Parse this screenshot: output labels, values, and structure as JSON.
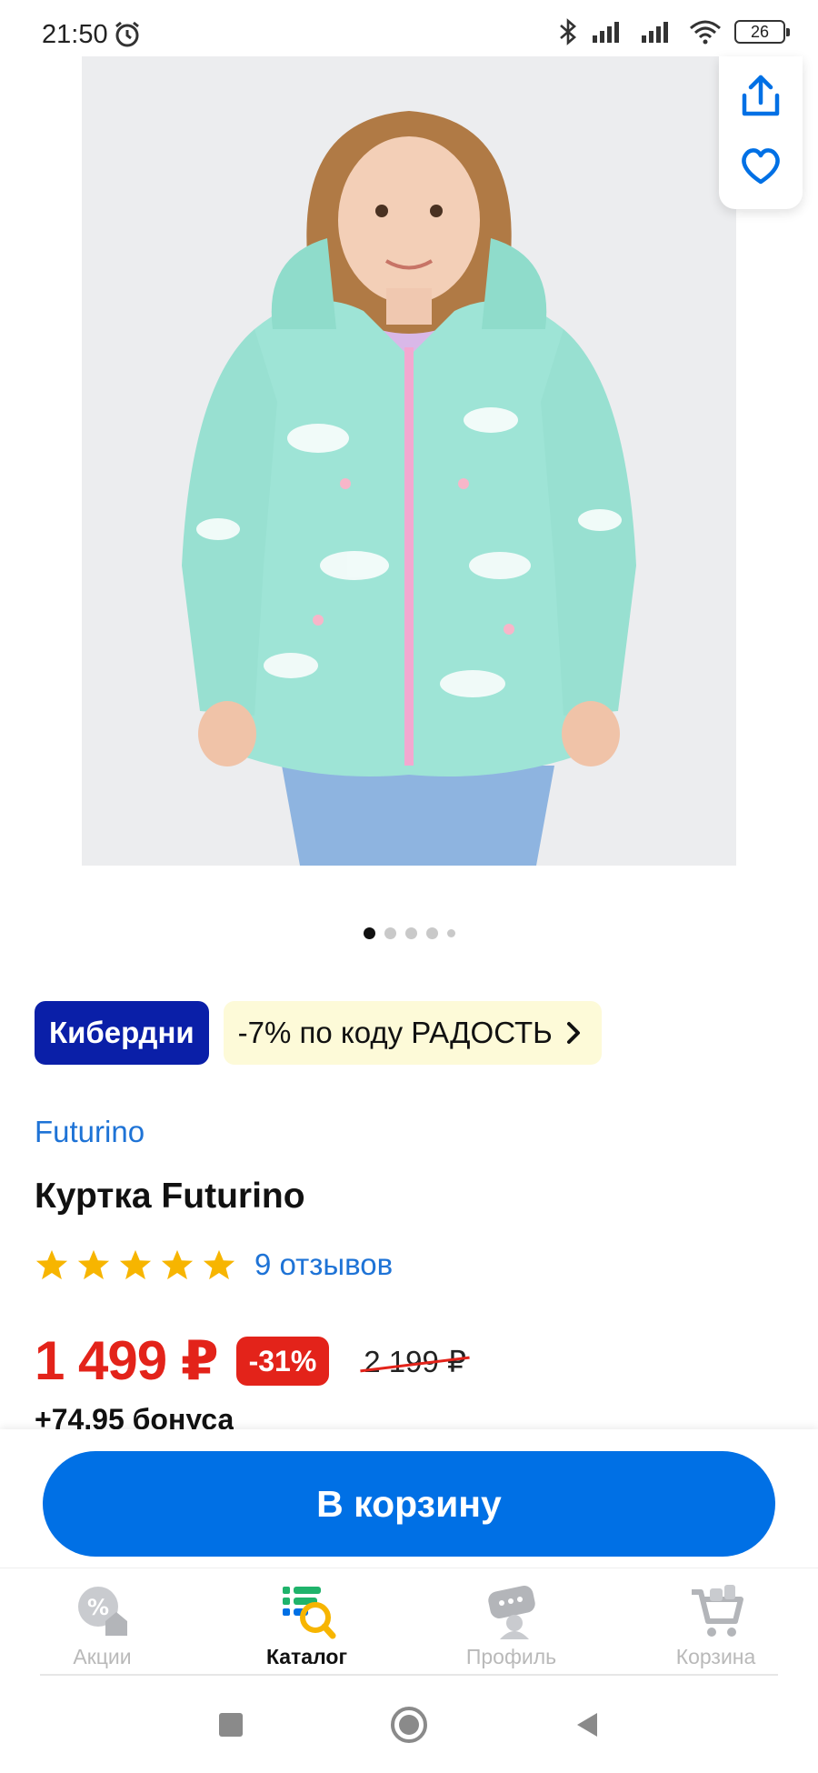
{
  "status_bar": {
    "time": "21:50",
    "battery": "26"
  },
  "floating_actions": {
    "share_icon": "share-icon",
    "favorite_icon": "heart-icon"
  },
  "gallery": {
    "dots": 5,
    "active_index": 0
  },
  "promo": {
    "badge_label": "Кибердни",
    "code_label": "-7% по коду РАДОСТЬ"
  },
  "product": {
    "brand": "Futurino",
    "title": "Куртка Futurino",
    "rating": 5,
    "reviews_label": "9 отзывов",
    "price": "1 499 ₽",
    "discount": "-31%",
    "old_price": "2 199 ₽",
    "bonus": "+74,95 бонуса"
  },
  "cart_button_label": "В корзину",
  "tabs": [
    {
      "label": "Акции",
      "icon": "percent-house-icon",
      "active": false
    },
    {
      "label": "Каталог",
      "icon": "catalog-search-icon",
      "active": true
    },
    {
      "label": "Профиль",
      "icon": "profile-icon",
      "active": false
    },
    {
      "label": "Корзина",
      "icon": "cart-icon",
      "active": false
    }
  ],
  "colors": {
    "accent_blue": "#0070e5",
    "promo_dark": "#0a1fa8",
    "price_red": "#e3231a",
    "link_blue": "#1e73d6",
    "star_yellow": "#f7b500"
  }
}
